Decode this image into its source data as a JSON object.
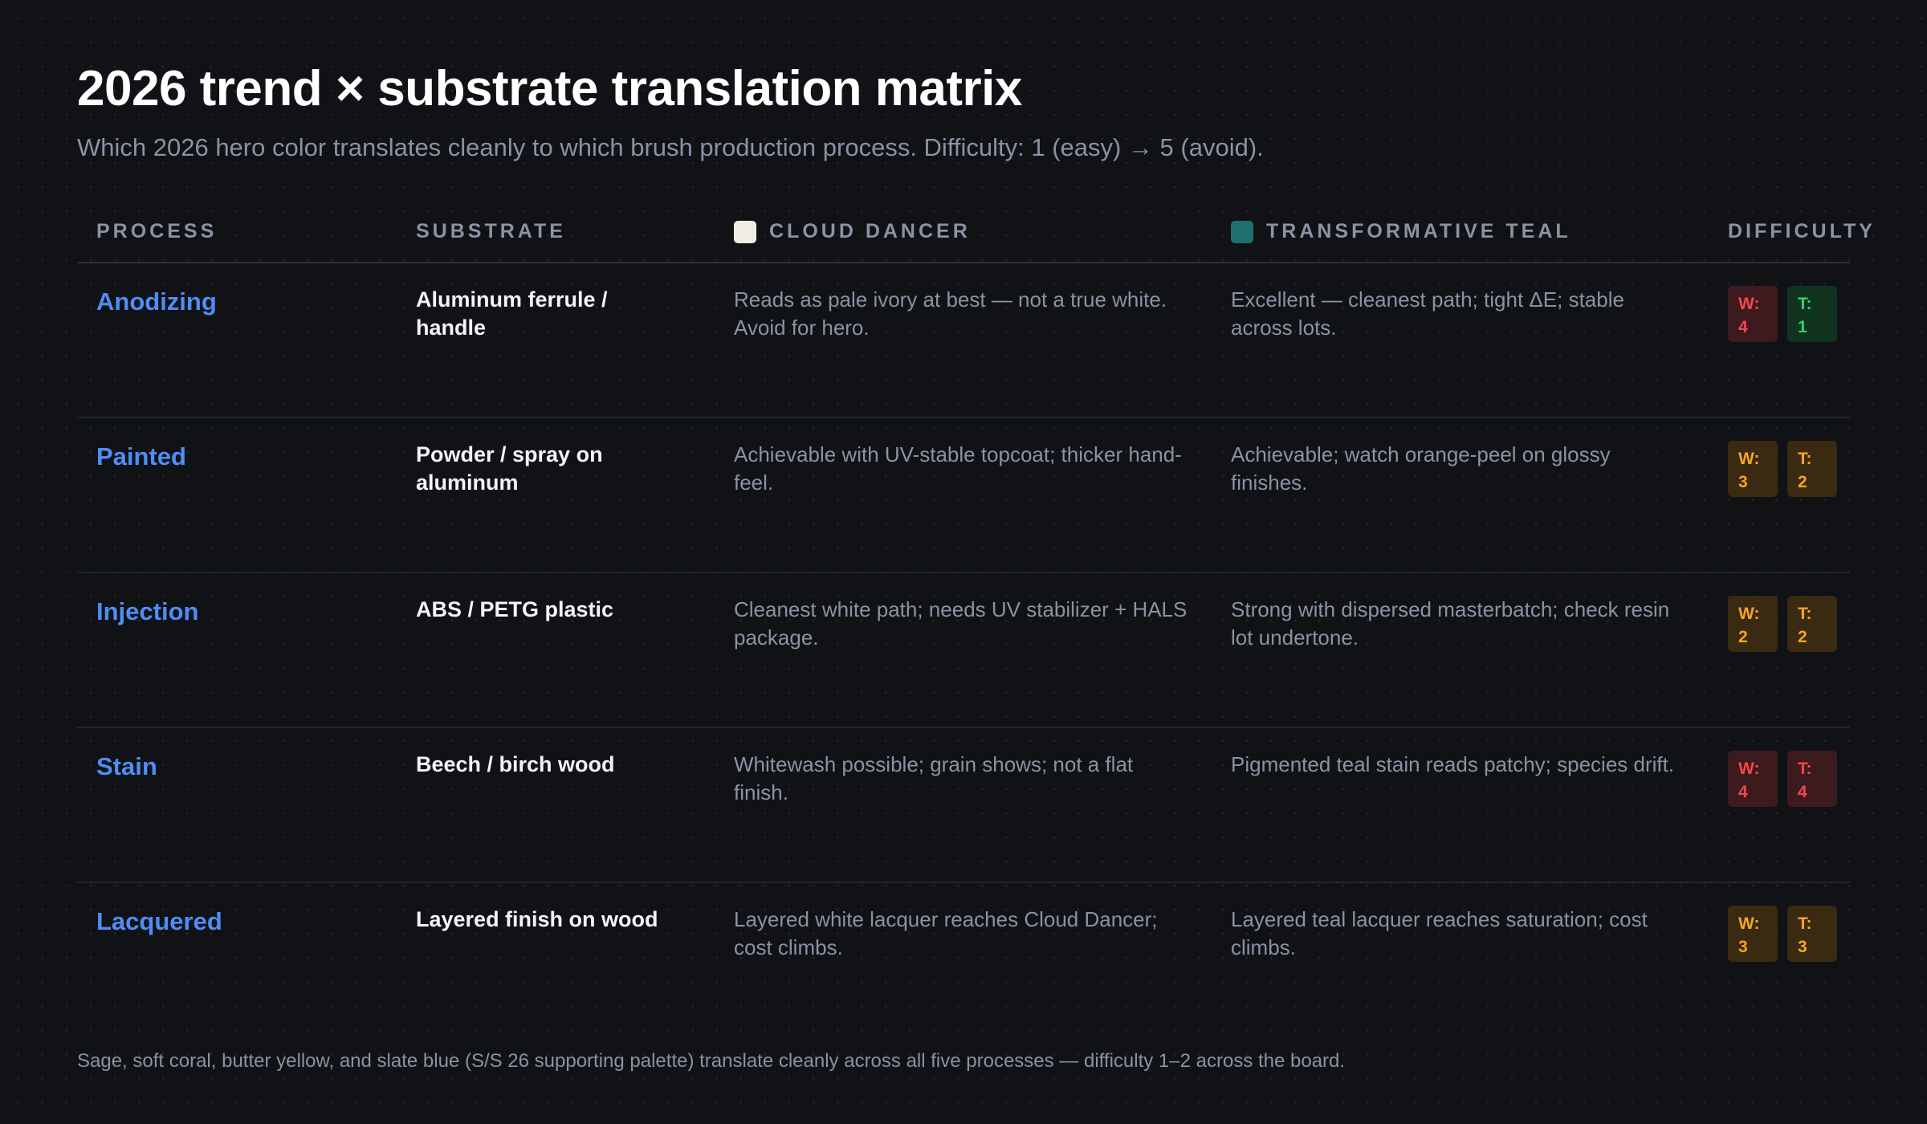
{
  "header": {
    "title": "2026 trend × substrate translation matrix",
    "subtitle": "Which 2026 hero color translates cleanly to which brush production process. Difficulty: 1 (easy) → 5 (avoid)."
  },
  "columns": {
    "process": "PROCESS",
    "substrate": "SUBSTRATE",
    "cloud_dancer": "CLOUD DANCER",
    "teal": "TRANSFORMATIVE TEAL",
    "difficulty": "DIFFICULTY"
  },
  "swatch_colors": {
    "cloud_dancer": "#f1ece1",
    "teal": "#1f6f6f"
  },
  "difficulty_colors": {
    "easy": {
      "bg": "#10331f",
      "fg": "#34d26a"
    },
    "medium": {
      "bg": "#3a2a12",
      "fg": "#f5a524"
    },
    "hard": {
      "bg": "#3d1a1d",
      "fg": "#f2474f"
    }
  },
  "rows": [
    {
      "process": "Anodizing",
      "substrate": "Aluminum ferrule / handle",
      "cloud_dancer": "Reads as pale ivory at best — not a true white. Avoid for hero.",
      "teal": "Excellent — cleanest path; tight ΔE; stable across lots.",
      "w_label": "W:",
      "w_value": "4",
      "w_level": "hard",
      "t_label": "T:",
      "t_value": "1",
      "t_level": "easy"
    },
    {
      "process": "Painted",
      "substrate": "Powder / spray on aluminum",
      "cloud_dancer": "Achievable with UV-stable topcoat; thicker hand-feel.",
      "teal": "Achievable; watch orange-peel on glossy finishes.",
      "w_label": "W:",
      "w_value": "3",
      "w_level": "medium",
      "t_label": "T:",
      "t_value": "2",
      "t_level": "medium"
    },
    {
      "process": "Injection",
      "substrate": "ABS / PETG plastic",
      "cloud_dancer": "Cleanest white path; needs UV stabilizer + HALS package.",
      "teal": "Strong with dispersed masterbatch; check resin lot undertone.",
      "w_label": "W:",
      "w_value": "2",
      "w_level": "medium",
      "t_label": "T:",
      "t_value": "2",
      "t_level": "medium"
    },
    {
      "process": "Stain",
      "substrate": "Beech / birch wood",
      "cloud_dancer": "Whitewash possible; grain shows; not a flat finish.",
      "teal": "Pigmented teal stain reads patchy; species drift.",
      "w_label": "W:",
      "w_value": "4",
      "w_level": "hard",
      "t_label": "T:",
      "t_value": "4",
      "t_level": "hard"
    },
    {
      "process": "Lacquered",
      "substrate": "Layered finish on wood",
      "cloud_dancer": "Layered white lacquer reaches Cloud Dancer; cost climbs.",
      "teal": "Layered teal lacquer reaches saturation; cost climbs.",
      "w_label": "W:",
      "w_value": "3",
      "w_level": "medium",
      "t_label": "T:",
      "t_value": "3",
      "t_level": "medium"
    }
  ],
  "footnote": "Sage, soft coral, butter yellow, and slate blue (S/S 26 supporting palette) translate cleanly across all five processes — difficulty 1–2 across the board."
}
